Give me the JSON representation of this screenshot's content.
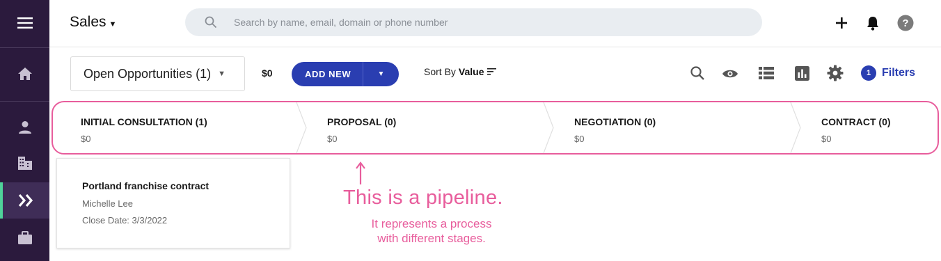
{
  "app": {
    "title": "Sales"
  },
  "search": {
    "placeholder": "Search by name, email, domain or phone number"
  },
  "icons": {
    "sidebar": [
      "menu-icon",
      "home-icon",
      "person-icon",
      "building-icon",
      "pipeline-icon",
      "briefcase-icon"
    ],
    "top": [
      "plus-icon",
      "bell-icon",
      "help-icon"
    ],
    "toolbar": [
      "search-icon",
      "eye-icon",
      "list-view-icon",
      "chart-view-icon",
      "gear-icon"
    ]
  },
  "toolbar": {
    "view": "Open Opportunities (1)",
    "total": "$0",
    "add_label": "ADD NEW",
    "sort_prefix": "Sort By",
    "sort_value": "Value",
    "filters_count": "1",
    "filters_label": "Filters"
  },
  "stages": [
    {
      "name": "INITIAL CONSULTATION (1)",
      "value": "$0"
    },
    {
      "name": "PROPOSAL (0)",
      "value": "$0"
    },
    {
      "name": "NEGOTIATION (0)",
      "value": "$0"
    },
    {
      "name": "CONTRACT (0)",
      "value": "$0"
    }
  ],
  "card": {
    "title": "Portland franchise contract",
    "contact": "Michelle Lee",
    "close_date": "Close Date: 3/3/2022"
  },
  "annotation": {
    "title": "This is a pipeline.",
    "line1": "It represents a process",
    "line2": "with different stages."
  },
  "colors": {
    "sidebar": "#2b1a3d",
    "accent": "#2a3eb1",
    "annotation": "#e85d9c",
    "active_indicator": "#4fd39a"
  }
}
